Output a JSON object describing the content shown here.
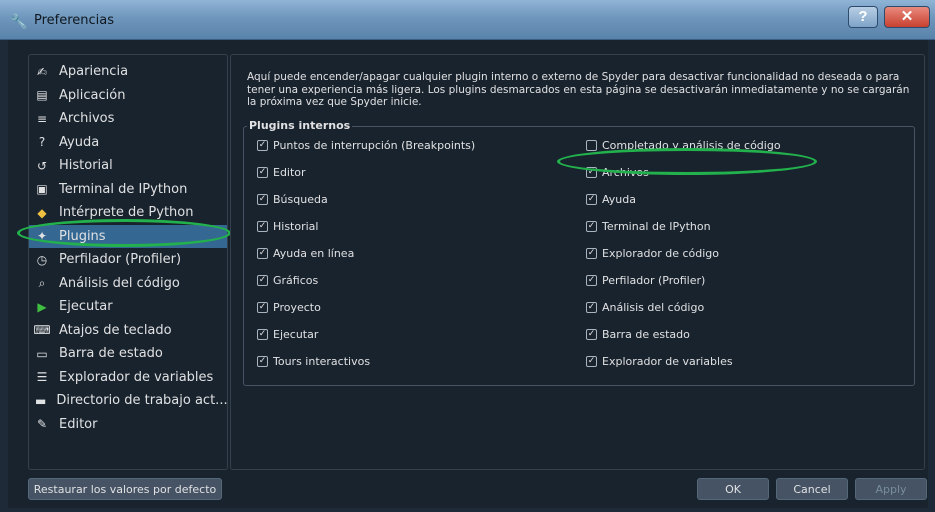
{
  "window": {
    "title": "Preferencias"
  },
  "sidebar": {
    "items": [
      {
        "label": "Apariencia",
        "icon": "paint-brush-icon"
      },
      {
        "label": "Aplicación",
        "icon": "window-icon"
      },
      {
        "label": "Archivos",
        "icon": "file-tree-icon"
      },
      {
        "label": "Ayuda",
        "icon": "help-icon"
      },
      {
        "label": "Historial",
        "icon": "history-icon"
      },
      {
        "label": "Terminal de IPython",
        "icon": "terminal-icon"
      },
      {
        "label": "Intérprete de Python",
        "icon": "python-icon"
      },
      {
        "label": "Plugins",
        "icon": "puzzle-icon",
        "selected": true
      },
      {
        "label": "Perfilador (Profiler)",
        "icon": "stopwatch-icon"
      },
      {
        "label": "Análisis del código",
        "icon": "code-analysis-icon"
      },
      {
        "label": "Ejecutar",
        "icon": "play-icon"
      },
      {
        "label": "Atajos de teclado",
        "icon": "keyboard-icon"
      },
      {
        "label": "Barra de estado",
        "icon": "status-bar-icon"
      },
      {
        "label": "Explorador de variables",
        "icon": "list-icon"
      },
      {
        "label": "Directorio de trabajo act...",
        "icon": "folder-icon"
      },
      {
        "label": "Editor",
        "icon": "pencil-icon"
      }
    ]
  },
  "main": {
    "description": "Aquí puede encender/apagar cualquier plugin interno o externo de Spyder para desactivar funcionalidad no deseada o para tener una experiencia más ligera. Los plugins desmarcados en esta página se desactivarán inmediatamente y no se cargarán la próxima vez que Spyder inicie.",
    "group_title": "Plugins internos",
    "left_plugins": [
      {
        "label": "Puntos de interrupción (Breakpoints)",
        "checked": true
      },
      {
        "label": "Editor",
        "checked": true
      },
      {
        "label": "Búsqueda",
        "checked": true
      },
      {
        "label": "Historial",
        "checked": true
      },
      {
        "label": "Ayuda en línea",
        "checked": true
      },
      {
        "label": "Gráficos",
        "checked": true
      },
      {
        "label": "Proyecto",
        "checked": true
      },
      {
        "label": "Ejecutar",
        "checked": true
      },
      {
        "label": "Tours interactivos",
        "checked": true
      }
    ],
    "right_plugins": [
      {
        "label": "Completado y análisis de código",
        "checked": false
      },
      {
        "label": "Archivos",
        "checked": true
      },
      {
        "label": "Ayuda",
        "checked": true
      },
      {
        "label": "Terminal de IPython",
        "checked": true
      },
      {
        "label": "Explorador de código",
        "checked": true
      },
      {
        "label": "Perfilador (Profiler)",
        "checked": true
      },
      {
        "label": "Análisis del código",
        "checked": true
      },
      {
        "label": "Barra de estado",
        "checked": true
      },
      {
        "label": "Explorador de variables",
        "checked": true
      }
    ]
  },
  "buttons": {
    "restore": "Restaurar los valores por defecto",
    "ok": "OK",
    "cancel": "Cancel",
    "apply": "Apply"
  },
  "colors": {
    "background": "#19232d",
    "selection": "#346792",
    "highlight_annotation": "#22b14c"
  }
}
